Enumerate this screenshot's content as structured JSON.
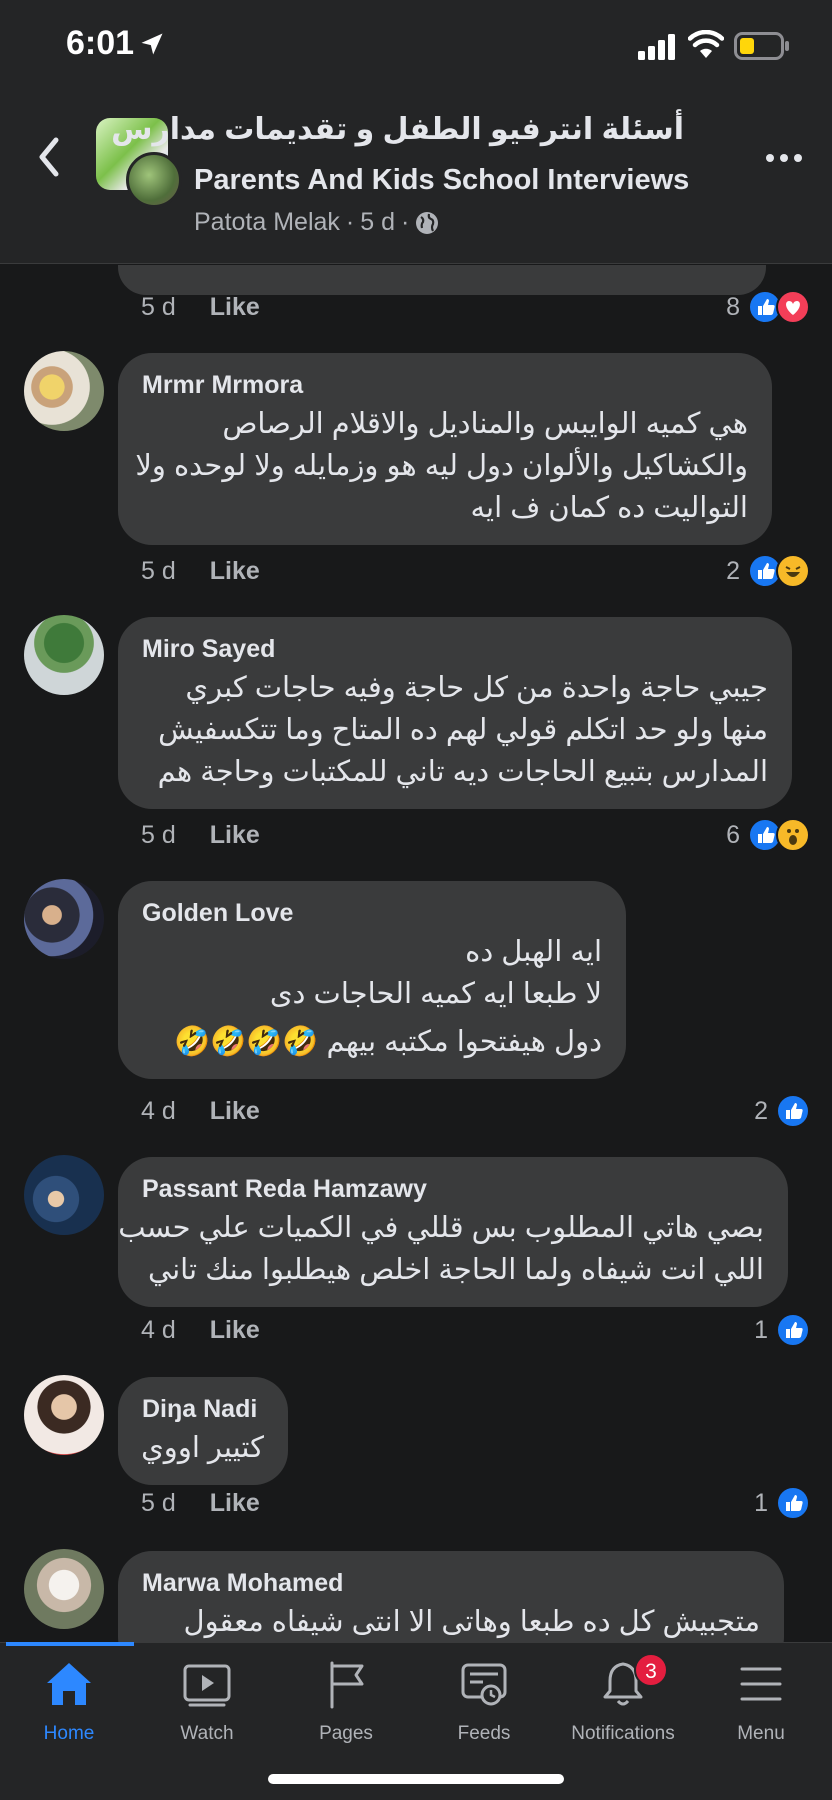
{
  "status_bar": {
    "time": "6:01"
  },
  "header": {
    "title_ar": "أسئلة انترفيو الطفل و تقديمات مدارس",
    "title_en": "Parents And Kids School Interviews",
    "author": "Patota Melak",
    "time": "5 d",
    "sep": "·"
  },
  "prev_comment": {
    "time": "5 d",
    "like": "Like",
    "reaction_count": "8",
    "reactions": [
      "like",
      "love"
    ]
  },
  "comments": [
    {
      "name": "Mrmr Mrmora",
      "lines": [
        "هي كميه الوايبس والمناديل والاقلام الرصاص",
        "والكشاكيل والألوان دول ليه هو وزمايله ولا لوحده ولا",
        "التواليت ده كمان ف ايه"
      ],
      "time": "5 d",
      "like": "Like",
      "reaction_count": "2",
      "reactions": [
        "like",
        "haha"
      ]
    },
    {
      "name": "Miro Sayed",
      "lines": [
        "جيبي حاجة واحدة من كل حاجة وفيه حاجات كبري",
        "منها ولو حد اتكلم قولي لهم ده المتاح وما تتكسفيش",
        "المدارس بتبيع الحاجات ديه تاني للمكتبات وحاجة هم"
      ],
      "time": "5 d",
      "like": "Like",
      "reaction_count": "6",
      "reactions": [
        "like",
        "wow"
      ]
    },
    {
      "name": "Golden Love",
      "lines": [
        "ايه الهبل ده",
        "لا طبعا ايه كميه الحاجات دى",
        "دول هيفتحوا مكتبه بيهم 🤣🤣🤣🤣"
      ],
      "time": "4 d",
      "like": "Like",
      "reaction_count": "2",
      "reactions": [
        "like"
      ]
    },
    {
      "name": "Passant Reda Hamzawy",
      "lines": [
        "بصي هاتي المطلوب بس قللي في الكميات علي حسب",
        "اللي انت شيفاه ولما الحاجة اخلص هيطلبوا منك تاني"
      ],
      "time": "4 d",
      "like": "Like",
      "reaction_count": "1",
      "reactions": [
        "like"
      ]
    },
    {
      "name": "Diŋa Nadi",
      "lines": [
        "كتيير اووي"
      ],
      "time": "5 d",
      "like": "Like",
      "reaction_count": "1",
      "reactions": [
        "like"
      ]
    },
    {
      "name": "Marwa Mohamed",
      "lines": [
        "متجبيش كل ده طبعا وهاتى الا انتى شيفاه معقول"
      ],
      "time": "",
      "like": "",
      "reaction_count": "",
      "reactions": []
    }
  ],
  "nav": {
    "items": [
      {
        "label": "Home",
        "icon": "home-icon",
        "active": true
      },
      {
        "label": "Watch",
        "icon": "watch-icon"
      },
      {
        "label": "Pages",
        "icon": "flag-icon"
      },
      {
        "label": "Feeds",
        "icon": "feeds-icon"
      },
      {
        "label": "Notifications",
        "icon": "bell-icon",
        "badge": "3"
      },
      {
        "label": "Menu",
        "icon": "menu-icon"
      }
    ]
  },
  "colors": {
    "accent": "#2d88ff",
    "badge": "#e41e3f",
    "background": "#18191a",
    "bubble": "#3a3b3c",
    "bar": "#242526"
  }
}
